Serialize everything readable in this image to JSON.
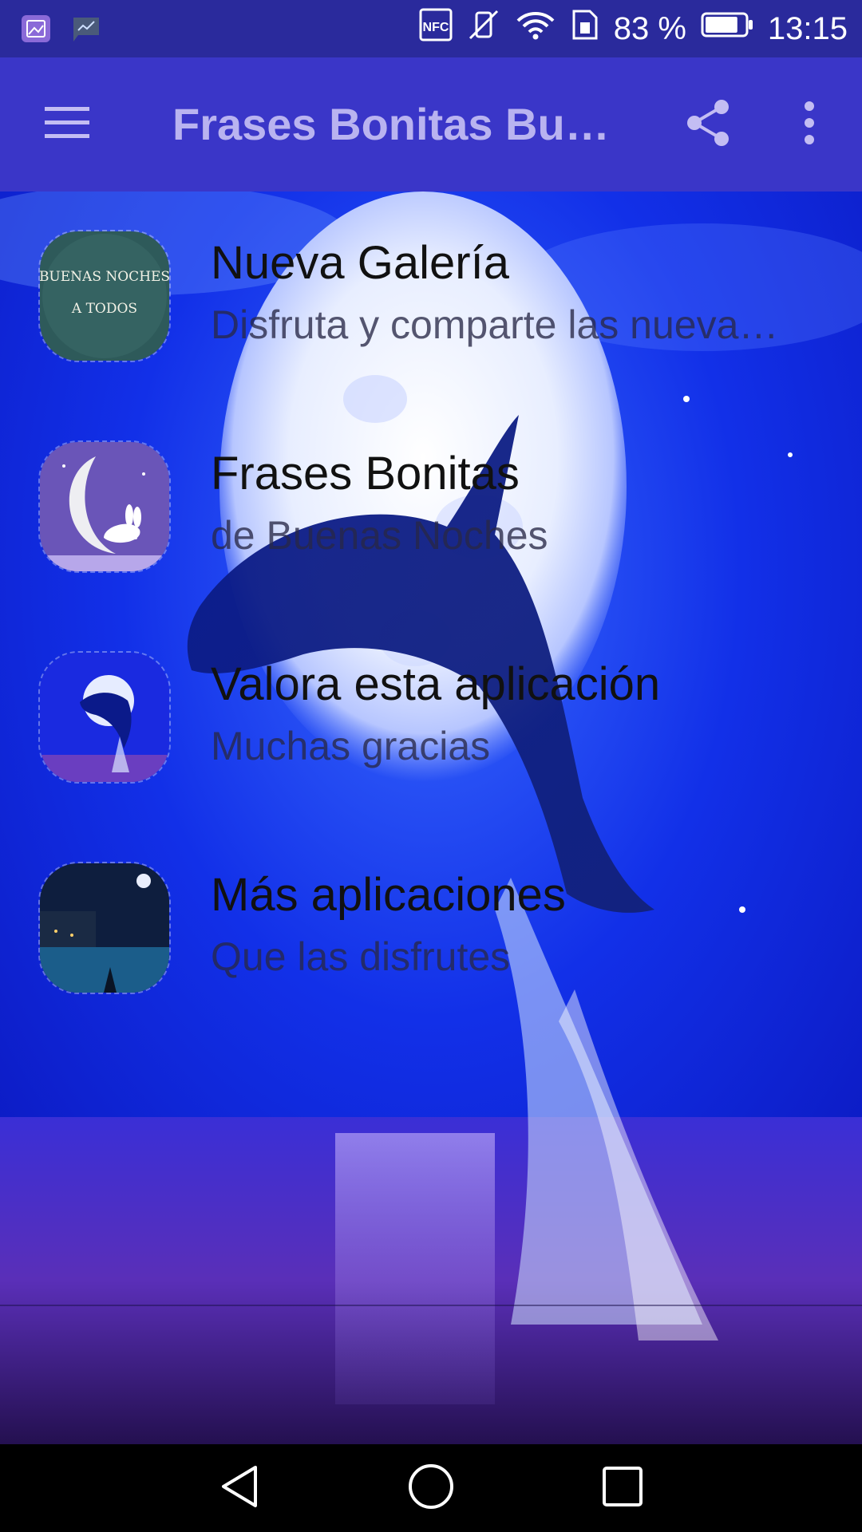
{
  "status_bar": {
    "nfc_label": "NFC",
    "battery_percent": "83 %",
    "battery_level": 0.83,
    "time": "13:15",
    "icons": [
      "gallery-notification-icon",
      "chart-notification-icon",
      "nfc-icon",
      "vibrate-off-icon",
      "wifi-icon",
      "sim-icon",
      "battery-icon"
    ]
  },
  "app_bar": {
    "title": "Frases Bonitas Bue…",
    "icons": [
      "menu-icon",
      "share-icon",
      "more-vert-icon"
    ]
  },
  "list": {
    "items": [
      {
        "title": "Nueva Galería",
        "subtitle": "Disfruta y comparte las nueva…",
        "thumb_text_line1": "BUENAS NOCHES",
        "thumb_text_line2": "A TODOS"
      },
      {
        "title": "Frases Bonitas",
        "subtitle": "de Buenas Noches"
      },
      {
        "title": "Valora esta aplicación",
        "subtitle": "Muchas gracias"
      },
      {
        "title": "Más aplicaciones",
        "subtitle": "Que las disfrutes"
      }
    ]
  },
  "nav_bar": {
    "icons": [
      "back-icon",
      "home-icon",
      "recents-icon"
    ]
  },
  "colors": {
    "status_bar": "#2a2a9c",
    "app_bar": "#3a36c8",
    "title": "#b9b3f0",
    "background_deep": "#0a1ad0",
    "nav_bar": "#000000"
  }
}
